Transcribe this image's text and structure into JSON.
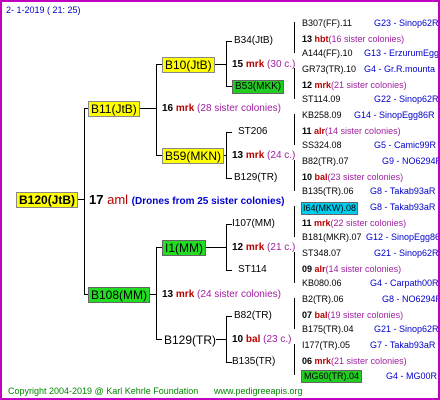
{
  "header": {
    "date": "2-  1-2019  ( 21:  25)"
  },
  "root": {
    "name": "B120(JtB)",
    "num": "17",
    "mark": "aml",
    "note": "(Drones from 25 sister colonies)"
  },
  "gen1": [
    {
      "name": "B11(JtB)",
      "num": "16",
      "mark": "mrk",
      "note": "(28 sister colonies)"
    },
    {
      "name": "B108(MM)",
      "num": "13",
      "mark": "mrk",
      "note": "(24 sister colonies)"
    }
  ],
  "gen2": [
    {
      "name": "B10(JtB)",
      "num": "15",
      "mark": "mrk",
      "note": "(30 c.)"
    },
    {
      "name": "B59(MKN)",
      "num": "13",
      "mark": "mrk",
      "note": "(24 c.)"
    },
    {
      "name": "I1(MM)",
      "num": "12",
      "mark": "mrk",
      "note": "(21 c.)"
    },
    {
      "name": "B129(TR)",
      "num": "10",
      "mark": "bal",
      "note": "(23 c.)"
    }
  ],
  "gen3": [
    {
      "name": "B34(JtB)"
    },
    {
      "name": "B53(MKK)"
    },
    {
      "name": "ST206"
    },
    {
      "name": "B129(TR)"
    },
    {
      "name": "I107(MM)"
    },
    {
      "name": "ST114"
    },
    {
      "name": "B82(TR)"
    },
    {
      "name": "B135(TR)"
    }
  ],
  "gen4": [
    {
      "top": "B307(FF).11",
      "topr": "G23 - Sinop62R",
      "num": "13",
      "mark": "hbt",
      "note": "(16 sister colonies)",
      "bot": "A144(FF).10",
      "botr": "G13 - ErzurumEgg8"
    },
    {
      "top": "GR73(TR).10",
      "topr": "G4 - Gr.R.mounta",
      "num": "12",
      "mark": "mrk",
      "note": "(21 sister colonies)",
      "bot": "ST114.09",
      "botr": "G22 - Sinop62R"
    },
    {
      "top": "KB258.09",
      "topr": "G14 - SinopEgg86R",
      "num": "11",
      "mark": "alr",
      "note": "(14 sister colonies)",
      "bot": "SS324.08",
      "botr": "G5 - Camic99R"
    },
    {
      "top": "B82(TR).07",
      "topr": "G9 - NO6294R",
      "num": "10",
      "mark": "bal",
      "note": "(23 sister colonies)",
      "bot": "B135(TR).06",
      "botr": "G8 - Takab93aR"
    },
    {
      "top": "I64(MKW).08",
      "topr": "G8 - Takab93aR",
      "num": "11",
      "mark": "mrk",
      "note": "(22 sister colonies)",
      "bot": "B181(MKR).07",
      "botr": "G12 - SinopEgg86R"
    },
    {
      "top": "ST348.07",
      "topr": "G21 - Sinop62R",
      "num": "09",
      "mark": "alr",
      "note": "(14 sister colonies)",
      "bot": "KB080.06",
      "botr": "G4 - Carpath00R"
    },
    {
      "top": "B2(TR).06",
      "topr": "G8 - NO6294R",
      "num": "07",
      "mark": "bal",
      "note": "(19 sister colonies)",
      "bot": "B175(TR).04",
      "botr": "G21 - Sinop62R"
    },
    {
      "top": "I177(TR).05",
      "topr": "G7 - Takab93aR",
      "num": "06",
      "mark": "mrk",
      "note": "(21 sister colonies)",
      "bot": "MG60(TR).04",
      "botr": "G4 - MG00R"
    }
  ],
  "footer": {
    "copyright": "Copyright 2004-2019 @ Karl Kehrle Foundation",
    "site": "www.pedigreeapis.org"
  }
}
